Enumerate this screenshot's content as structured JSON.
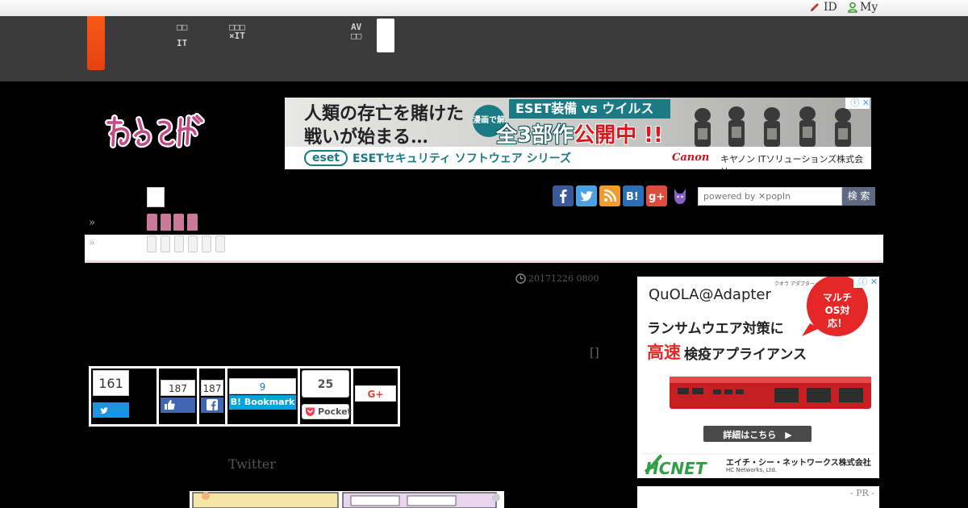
{
  "topbar": {
    "id_link": "ID",
    "my_link": "My"
  },
  "gnav": {
    "items": [
      {
        "line1": "□□",
        "line2": "IT"
      },
      {
        "line1": "□□□",
        "line2": "×IT"
      },
      {
        "line1": "AV",
        "line2": "□□"
      }
    ]
  },
  "ad_top": {
    "line1": "人類の存亡を賭けた",
    "line2": "戦いが始まる…",
    "badge": "漫画で解説",
    "title": "ESET装備 vs ウイルス",
    "headline_a": "全3部作",
    "headline_b": "公開中 !!",
    "eset_logo": "eset",
    "eset_text": "ESETセキュリティ ソフトウェア シリーズ",
    "canon": "Canon",
    "canon_text": "キヤノン ITソリューションズ株式会社",
    "close": "ⓘ ✕"
  },
  "search": {
    "placeholder": "powered by ✕popIn",
    "button": "検 索"
  },
  "social_icons": [
    "facebook-icon",
    "twitter-icon",
    "rss-icon",
    "hatena-icon",
    "google-plus-icon",
    "cat-icon"
  ],
  "breadcrumb": {
    "raquo1": "»",
    "raquo2": "»"
  },
  "article": {
    "date": "20171226 0800",
    "mark": "[]",
    "twitter_label": "Twitter"
  },
  "share": {
    "twitter_count": "161",
    "fb_like_count": "187",
    "fb_share_count": "187",
    "hatena_count": "9",
    "hatena_label": "B! Bookmark",
    "pocket_count": "25",
    "pocket_label": "Pocket",
    "gplus_label": "G+"
  },
  "ad_side": {
    "brand": "QuOLA@Adapter",
    "brand_sub": "クオラ アダプター",
    "bubble": "マルチOS対応！",
    "line1": "ランサムウエア対策に",
    "line2a": "高速",
    "line2b": "検疫アプライアンス",
    "cta": "詳細はこちら　▶",
    "company": "エイチ・シー・ネットワークス株式会社",
    "company_en": "HC Networks, Ltd.",
    "logo": "HCNET",
    "close": "ⓘ ✕"
  },
  "pr": {
    "label": "- PR -"
  },
  "colors": {
    "nav_bg": "#3b3b3b",
    "logo_orange": "#f14a13",
    "pink_tab": "#c97a9a",
    "eset_teal": "#1a7b84",
    "twitter_blue": "#1b95e0",
    "facebook_blue": "#4267b2",
    "hatena_blue": "#00a4de"
  }
}
